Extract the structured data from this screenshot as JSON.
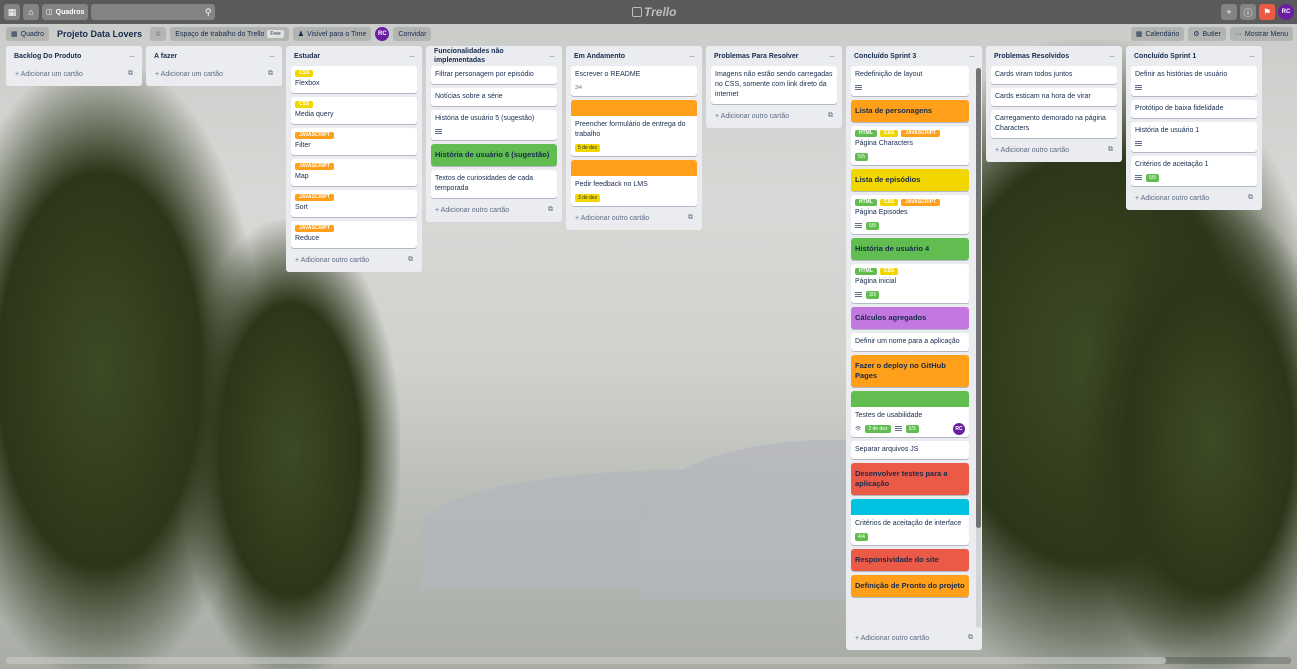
{
  "colors": {
    "green": "#61bd4f",
    "yellow": "#f2d600",
    "orange": "#ff9f1a",
    "red": "#eb5a46",
    "purple": "#c377e0",
    "blue": "#00c2e0"
  },
  "topbar": {
    "boards_label": "Quadros",
    "logo": "Trello",
    "avatar": "RC"
  },
  "board": {
    "view_label": "Quadro",
    "title": "Projeto Data Lovers",
    "workspace": "Espaço de trabalho do Trello",
    "free_badge": "Free",
    "visibility": "Visível para o Time",
    "member_avatar": "RC",
    "invite": "Convidar",
    "calendar": "Calendário",
    "butler": "Butler",
    "show_menu": "Mostrar Menu"
  },
  "add_card_label": "Adicionar um cartão",
  "add_other_card_label": "Adicionar outro cartão",
  "lists": [
    {
      "title": "Backlog Do Produto",
      "cards": [],
      "add": "Adicionar um cartão"
    },
    {
      "title": "A fazer",
      "cards": [],
      "add": "Adicionar um cartão"
    },
    {
      "title": "Estudar",
      "add": "Adicionar outro cartão",
      "cards": [
        {
          "labels": [
            {
              "text": "CSS",
              "color": "yellow"
            }
          ],
          "text": "Flexbox"
        },
        {
          "labels": [
            {
              "text": "CSS",
              "color": "yellow"
            }
          ],
          "text": "Media query"
        },
        {
          "labels": [
            {
              "text": "JAVASCRIPT",
              "color": "orange"
            }
          ],
          "text": "Filter"
        },
        {
          "labels": [
            {
              "text": "JAVASCRIPT",
              "color": "orange"
            }
          ],
          "text": "Map"
        },
        {
          "labels": [
            {
              "text": "JAVASCRIPT",
              "color": "orange"
            }
          ],
          "text": "Sort"
        },
        {
          "labels": [
            {
              "text": "JAVASCRIPT",
              "color": "orange"
            }
          ],
          "text": "Reduce"
        }
      ]
    },
    {
      "title": "Funcionalidades não implementadas",
      "add": "Adicionar outro cartão",
      "cards": [
        {
          "text": "Filtrar personagem por episódio"
        },
        {
          "text": "Notícias sobre a série"
        },
        {
          "text": "História de usuário 5 (sugestão)",
          "desc": true
        },
        {
          "text": "História de usuário 6 (sugestão)",
          "color": "green"
        },
        {
          "text": "Textos de curiosidades de cada temporada"
        }
      ]
    },
    {
      "title": "Em Andamento",
      "add": "Adicionar outro cartão",
      "cards": [
        {
          "text": "Escrever o README",
          "checklist": "3/4"
        },
        {
          "cover": "orange",
          "text": "Preencher formulário de entrega do trabalho",
          "due": "5 de dez"
        },
        {
          "cover": "orange",
          "text": "Pedir feedback no LMS",
          "due": "3 de dez"
        }
      ]
    },
    {
      "title": "Problemas Para Resolver",
      "add": "Adicionar outro cartão",
      "cards": [
        {
          "text": "Imagens não estão sendo carregadas no CSS, somente com link direto da internet"
        }
      ]
    },
    {
      "title": "Concluído Sprint 3",
      "add": "Adicionar outro cartão",
      "cards": [
        {
          "text": "Redefinição de layout",
          "desc": true
        },
        {
          "text": "Lista de personagens",
          "color": "orange"
        },
        {
          "labels": [
            {
              "text": "HTML",
              "color": "green"
            },
            {
              "text": "CSS",
              "color": "yellow"
            },
            {
              "text": "JAVASCRIPT",
              "color": "orange"
            }
          ],
          "text": "Página Characters",
          "checklist_green": "5/5"
        },
        {
          "text": "Lista de episódios",
          "color": "yellow"
        },
        {
          "labels": [
            {
              "text": "HTML",
              "color": "green"
            },
            {
              "text": "CSS",
              "color": "yellow"
            },
            {
              "text": "JAVASCRIPT",
              "color": "orange"
            }
          ],
          "text": "Página Episodes",
          "desc": true,
          "checklist_green": "5/5"
        },
        {
          "text": "História de usuário 4",
          "color": "green"
        },
        {
          "labels": [
            {
              "text": "HTML",
              "color": "green"
            },
            {
              "text": "CSS",
              "color": "yellow"
            }
          ],
          "text": "Página inicial",
          "desc": true,
          "checklist_green": "3/3"
        },
        {
          "text": "Cálculos agregados",
          "color": "purple"
        },
        {
          "text": "Definir um nome para a aplicação"
        },
        {
          "text": "Fazer o deploy no GitHub Pages",
          "color": "orange"
        },
        {
          "cover": "green",
          "text": "Testes de usabilidade",
          "watch": true,
          "due_green": "2 de dez",
          "desc": true,
          "checklist_green": "3/3",
          "member": "RC"
        },
        {
          "text": "Separar arquivos JS"
        },
        {
          "text": "Desenvolver testes para a aplicação",
          "color": "red"
        },
        {
          "cover": "blue",
          "text": "Critérios de aceitação de interface",
          "checklist_green": "4/4"
        },
        {
          "text": "Responsividade do site",
          "color": "red"
        },
        {
          "text": "Definição de Pronto do projeto",
          "color": "orange"
        }
      ]
    },
    {
      "title": "Problemas Resolvidos",
      "add": "Adicionar outro cartão",
      "cards": [
        {
          "text": "Cards viram todos juntos"
        },
        {
          "text": "Cards esticam na hora de virar"
        },
        {
          "text": "Carregamento demorado na página Characters"
        }
      ]
    },
    {
      "title": "Concluído Sprint 1",
      "add": "Adicionar outro cartão",
      "cards": [
        {
          "text": "Definir as histórias de usuário",
          "desc": true
        },
        {
          "text": "Protótipo de baixa fidelidade"
        },
        {
          "text": "História de usuário 1",
          "desc": true
        },
        {
          "text": "Critérios de aceitação 1",
          "desc": true,
          "checklist_green": "5/5"
        }
      ]
    }
  ]
}
